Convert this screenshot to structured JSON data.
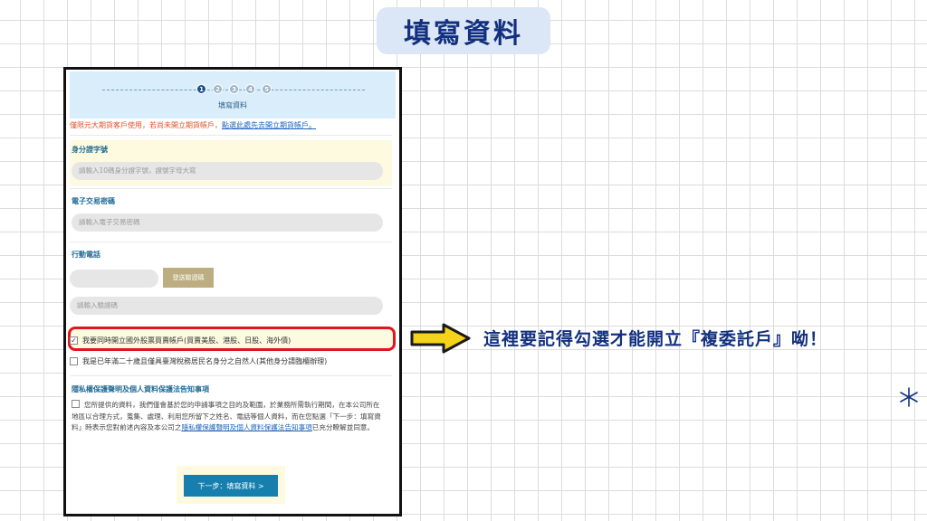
{
  "header": {
    "title": "填寫資料"
  },
  "steps": {
    "numbers": [
      "1",
      "2",
      "3",
      "4",
      "5"
    ],
    "current": 1,
    "label": "填寫資料"
  },
  "notice": {
    "text": "僅限元大期貨客戶使用，若尚未開立期貨帳戶，",
    "link": "點選此處先去開立期貨帳戶。"
  },
  "id_section": {
    "label": "身分證字號",
    "placeholder": "請輸入10碼身分證字號，證號字母大寫"
  },
  "password_section": {
    "label": "電子交易密碼",
    "placeholder": "請輸入電子交易密碼"
  },
  "mobile_section": {
    "label": "行動電話",
    "phone_value": "",
    "verify_button": "發送驗證碼",
    "code_placeholder": "請輸入驗證碼"
  },
  "checks": {
    "foreign_trading": {
      "label": "我要同時開立國外股票買賣帳戶(買賣美股、港股、日股、海外債)",
      "checked": true
    },
    "tax_resident": {
      "label": "我是已年滿二十歲且僅具臺灣稅務居民名身分之自然人(其他身分請臨櫃辦理)",
      "checked": false
    }
  },
  "privacy": {
    "title": "隱私權保護聲明及個人資料保護法告知事項",
    "text_1": "您所提供的資料，我們僅會基於您的申請事項之目的及範圍，於業務所需執行期間，在本公司所在地區以合理方式，蒐集、處理、利用您所留下之姓名、電話等個人資料，而在您點選「下一步：填寫資料」時表示您對前述內容及本公司之",
    "link": "隱私權保護聲明及個人資料保護法告知事項",
    "text_2": "已充分瞭解並同意。",
    "checked": false
  },
  "next_button": {
    "label": "下一步：填寫資料 >"
  },
  "callout": {
    "text": "這裡要記得勾選才能開立『複委託戶』呦！"
  },
  "colors": {
    "accent_navy": "#12307f",
    "highlight_red": "#e0161e",
    "arrow_yellow": "#f6d31b",
    "button_blue": "#167fae",
    "section_cream": "#fdfae0"
  },
  "icons": {
    "arrow": "right-arrow-icon",
    "sparkle": "sparkle-icon",
    "check": "checkbox-icon"
  }
}
